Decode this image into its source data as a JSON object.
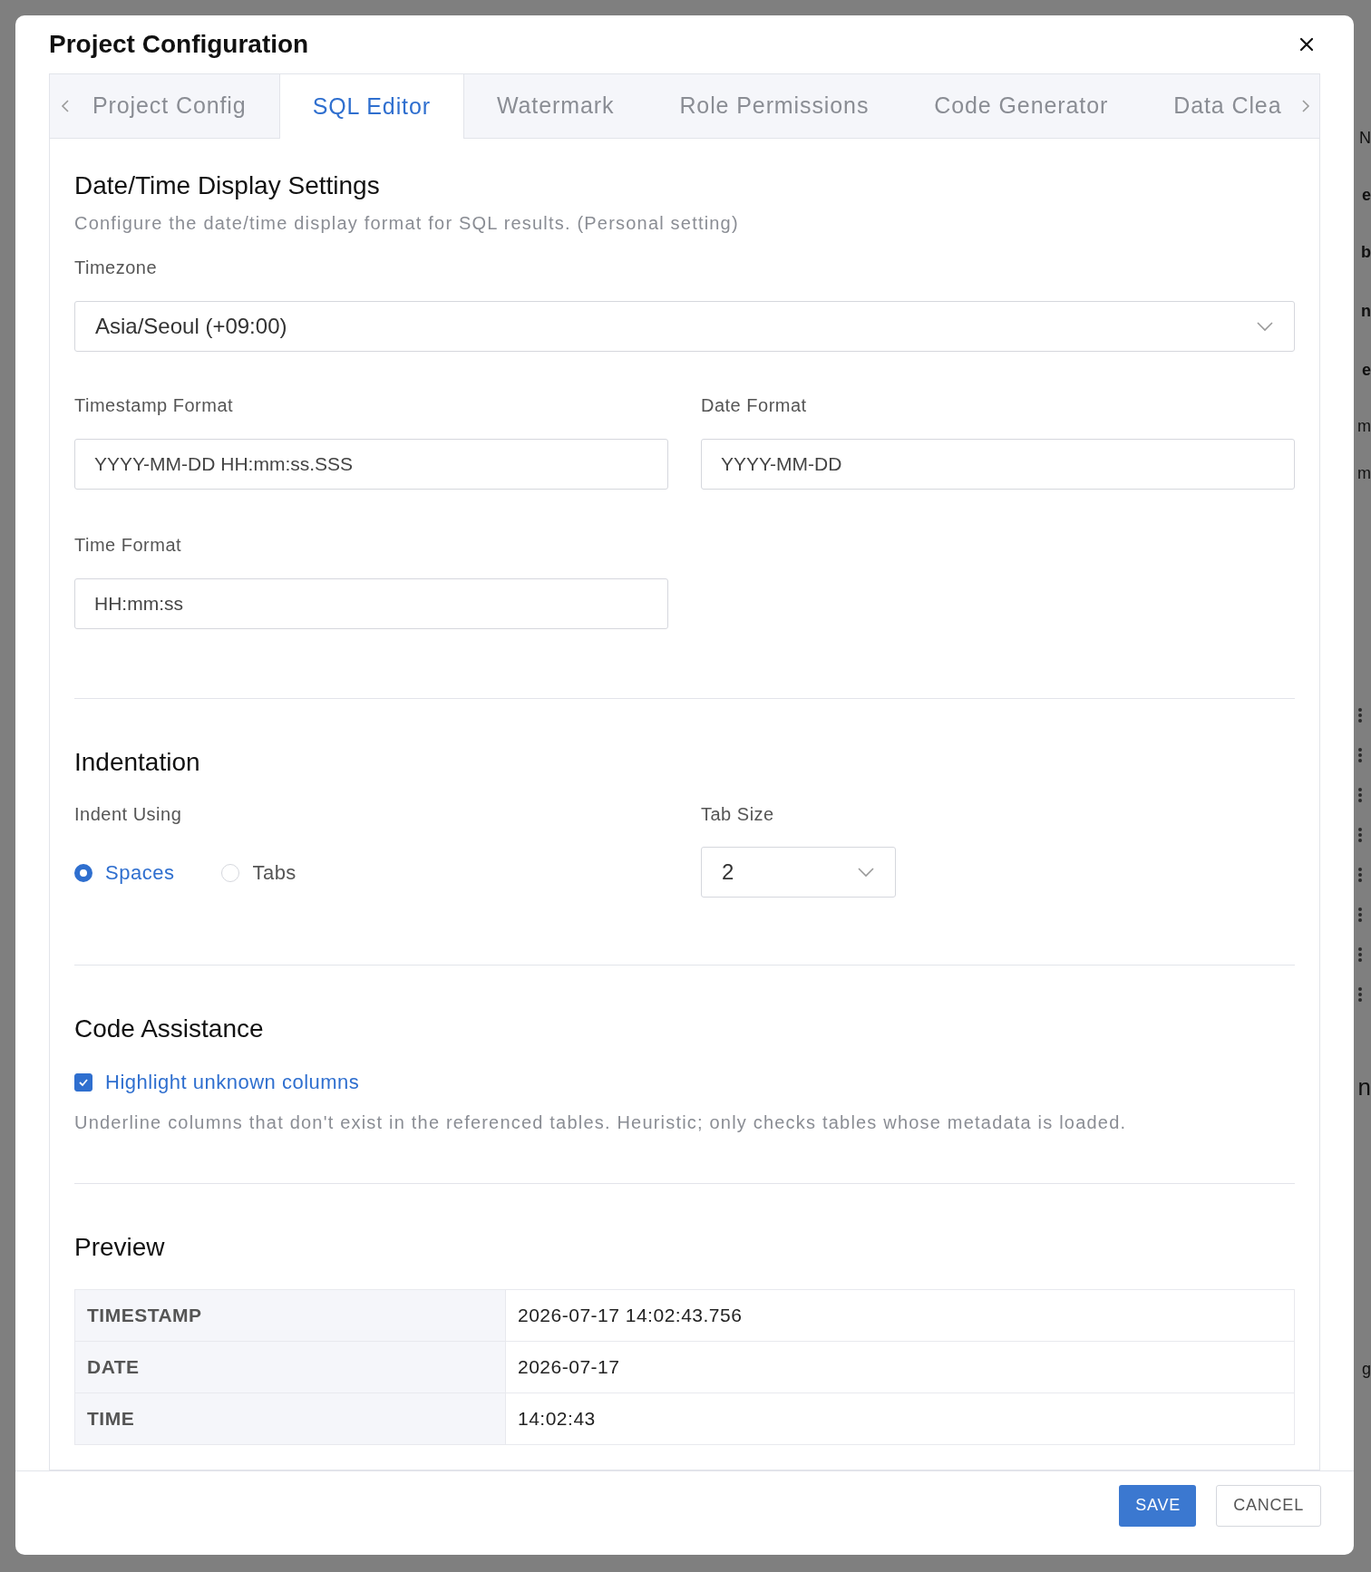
{
  "background": {
    "fragments": [
      {
        "text": "N",
        "kind": "plain"
      },
      {
        "text": "e",
        "kind": "bold"
      },
      {
        "text": "b",
        "kind": "bold"
      },
      {
        "text": "n",
        "kind": "bold"
      },
      {
        "text": "e",
        "kind": "bold"
      },
      {
        "text": "m",
        "kind": "plain"
      },
      {
        "text": "m",
        "kind": "plain"
      },
      {
        "text": "n",
        "kind": "heading"
      },
      {
        "text": "g",
        "kind": "plain"
      }
    ]
  },
  "dialog": {
    "title": "Project Configuration",
    "tabs": [
      {
        "label": "Project Config",
        "selected": false
      },
      {
        "label": "SQL Editor",
        "selected": true
      },
      {
        "label": "Watermark",
        "selected": false
      },
      {
        "label": "Role Permissions",
        "selected": false
      },
      {
        "label": "Code Generator",
        "selected": false
      },
      {
        "label": "Data Clea",
        "selected": false
      }
    ],
    "datetime": {
      "title": "Date/Time Display Settings",
      "description": "Configure the date/time display format for SQL results. (Personal setting)",
      "timezone": {
        "label": "Timezone",
        "value": "Asia/Seoul (+09:00)"
      },
      "timestamp_format": {
        "label": "Timestamp Format",
        "value": "YYYY-MM-DD HH:mm:ss.SSS"
      },
      "date_format": {
        "label": "Date Format",
        "value": "YYYY-MM-DD"
      },
      "time_format": {
        "label": "Time Format",
        "value": "HH:mm:ss"
      }
    },
    "indentation": {
      "title": "Indentation",
      "indent_label": "Indent Using",
      "options": [
        {
          "label": "Spaces",
          "selected": true
        },
        {
          "label": "Tabs",
          "selected": false
        }
      ],
      "tab_size": {
        "label": "Tab Size",
        "value": "2"
      }
    },
    "code_assistance": {
      "title": "Code Assistance",
      "checkbox": {
        "label": "Highlight unknown columns",
        "checked": true
      },
      "description": "Underline columns that don't exist in the referenced tables. Heuristic; only checks tables whose metadata is loaded."
    },
    "preview": {
      "title": "Preview",
      "rows": [
        {
          "key": "TIMESTAMP",
          "value": "2026-07-17 14:02:43.756"
        },
        {
          "key": "DATE",
          "value": "2026-07-17"
        },
        {
          "key": "TIME",
          "value": "14:02:43"
        }
      ]
    },
    "buttons": [
      {
        "label": "SAVE",
        "kind": "primary"
      },
      {
        "label": "CANCEL",
        "kind": "secondary"
      }
    ]
  }
}
